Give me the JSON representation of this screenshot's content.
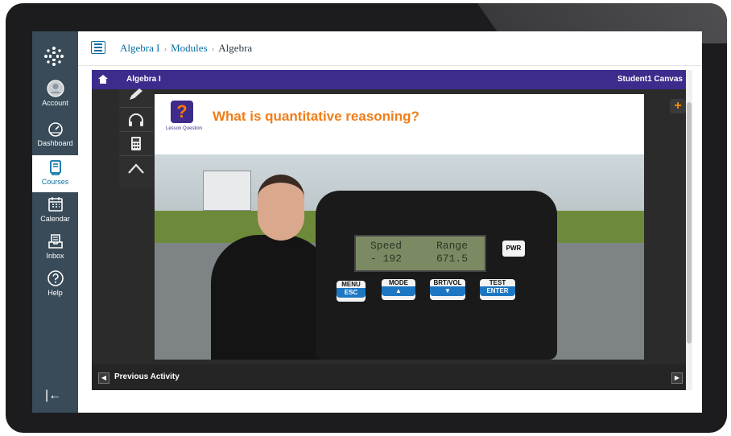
{
  "nav": {
    "items": [
      {
        "label": "Account",
        "icon": "account-icon"
      },
      {
        "label": "Dashboard",
        "icon": "dashboard-icon"
      },
      {
        "label": "Courses",
        "icon": "courses-icon"
      },
      {
        "label": "Calendar",
        "icon": "calendar-icon"
      },
      {
        "label": "Inbox",
        "icon": "inbox-icon"
      },
      {
        "label": "Help",
        "icon": "help-icon"
      }
    ]
  },
  "breadcrumb": {
    "course": "Algebra I",
    "section": "Modules",
    "current": "Algebra",
    "separator": "›"
  },
  "lesson": {
    "title": "Algebra I",
    "user": "Student1 Canvas",
    "question_label": "Lesson Question",
    "question_title": "What is quantitative reasoning?",
    "prev_label": "Previous Activity",
    "plus_label": "+"
  },
  "radar": {
    "speed_label": "Speed",
    "speed_value": "- 192",
    "range_label": "Range",
    "range_value": "671.5",
    "pwr": "PWR",
    "menu": "MENU",
    "esc": "ESC",
    "mode": "MODE",
    "brt": "BRT/VOL",
    "test": "TEST",
    "enter": "ENTER"
  },
  "colors": {
    "nav_bg": "#394b58",
    "brand": "#3e2b8c",
    "accent": "#f07d17",
    "link": "#0770a3"
  }
}
